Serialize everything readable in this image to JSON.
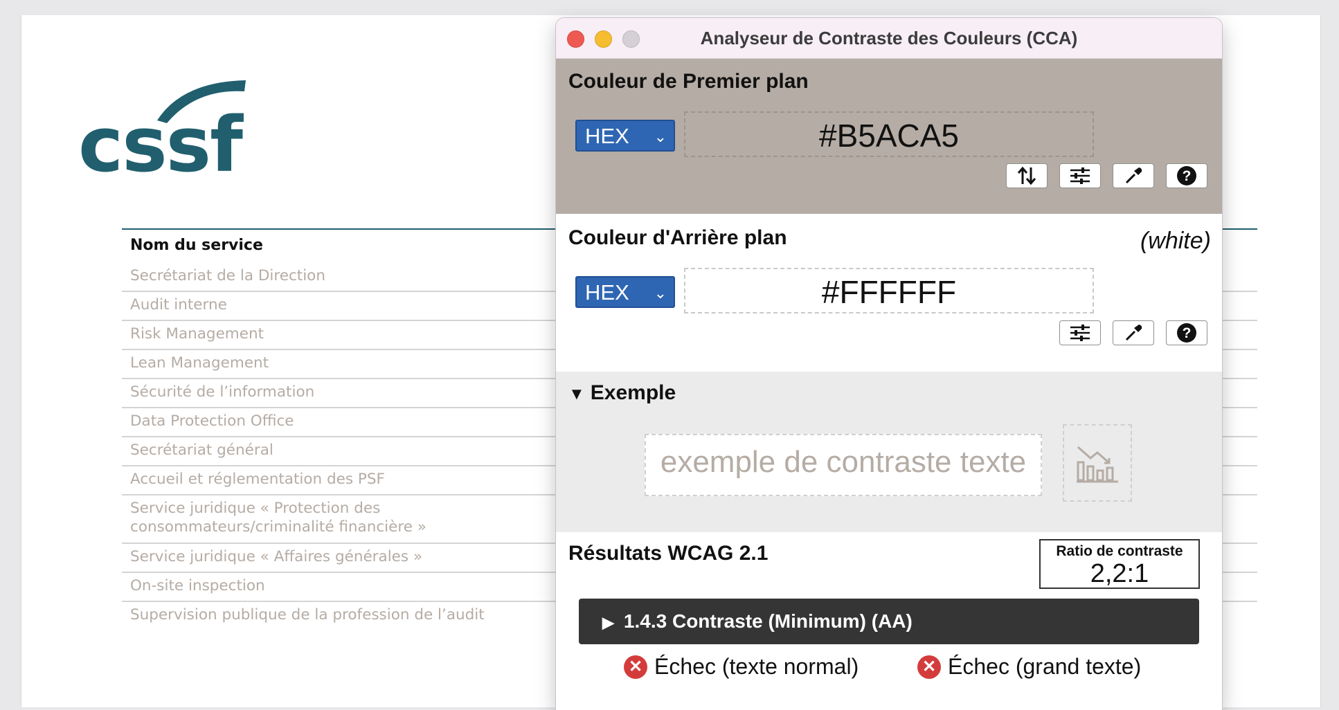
{
  "document": {
    "logo_text": "cssf",
    "table_header": "Nom du service",
    "services": [
      "Secrétariat de la Direction",
      "Audit interne",
      "Risk Management",
      "Lean Management",
      "Sécurité de l’information",
      "Data Protection Office",
      "Secrétariat général",
      "Accueil et réglementation des PSF",
      "Service juridique « Protection des consommateurs/criminalité financière »",
      "Service juridique « Affaires générales »",
      "On-site inspection",
      "Supervision publique de la profession de l’audit"
    ]
  },
  "window": {
    "title": "Analyseur de Contraste des Couleurs (CCA)"
  },
  "foreground": {
    "title": "Couleur de Premier plan",
    "format": "HEX",
    "value": "#B5ACA5",
    "color": "#B5ACA5"
  },
  "background": {
    "title": "Couleur d'Arrière plan",
    "name_note": "(white)",
    "format": "HEX",
    "value": "#FFFFFF",
    "color": "#FFFFFF"
  },
  "example": {
    "title": "Exemple",
    "sample_text": "exemple de contraste texte"
  },
  "results": {
    "title": "Résultats WCAG 2.1",
    "ratio_label": "Ratio de contraste",
    "ratio_value": "2,2:1",
    "criterion": "1.4.3 Contraste (Minimum) (AA)",
    "normal_text": "Échec (texte normal)",
    "large_text": "Échec (grand texte)"
  },
  "icons": {
    "swap": "swap-arrows-icon",
    "sliders": "sliders-icon",
    "eyedropper": "eyedropper-icon",
    "help": "help-icon",
    "chart": "chart-icon",
    "fail": "fail-x-icon"
  }
}
